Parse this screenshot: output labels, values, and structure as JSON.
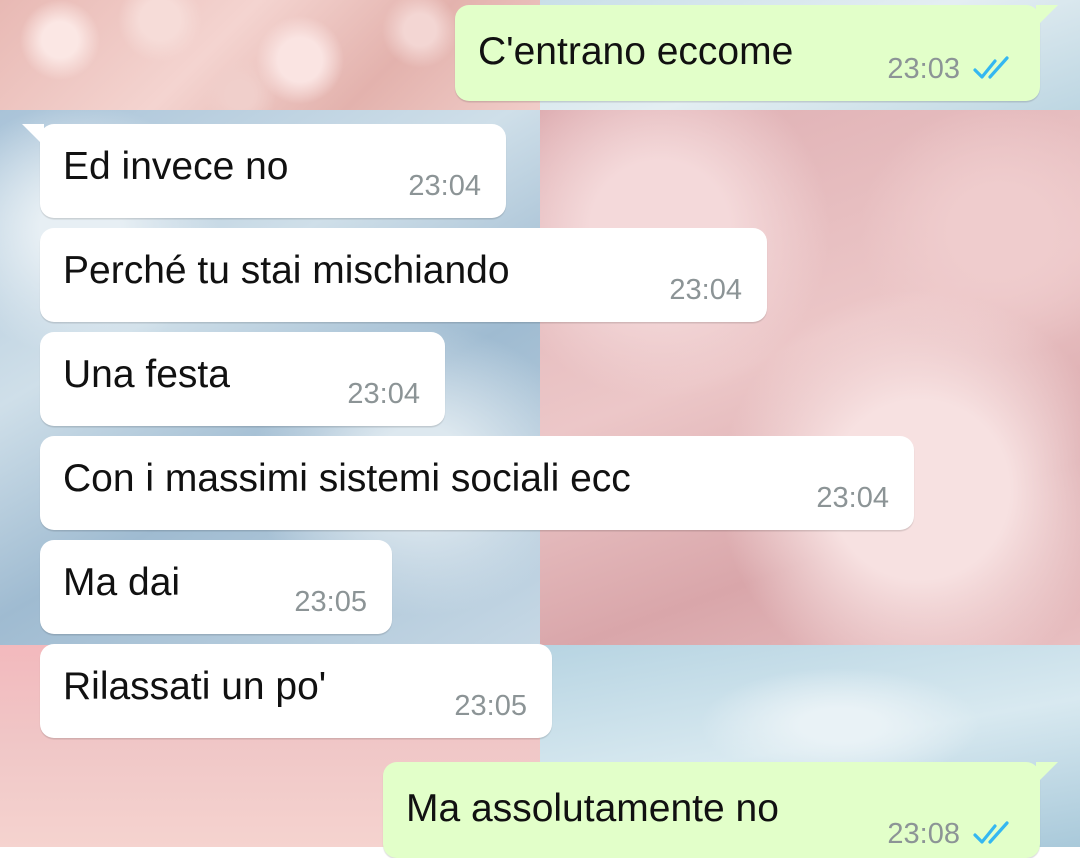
{
  "theme": {
    "incoming_bubble_color": "#ffffff",
    "outgoing_bubble_color": "#e2ffc9",
    "timestamp_color": "#8c9496",
    "read_ticks_color": "#34b7f1"
  },
  "messages": [
    {
      "direction": "outgoing",
      "text": "C'entrano eccome",
      "time": "23:03",
      "status": "read",
      "status_icon": "double-check-icon"
    },
    {
      "direction": "incoming",
      "text": "Ed invece no",
      "time": "23:04"
    },
    {
      "direction": "incoming",
      "text": "Perché tu stai mischiando",
      "time": "23:04"
    },
    {
      "direction": "incoming",
      "text": "Una festa",
      "time": "23:04"
    },
    {
      "direction": "incoming",
      "text": "Con i massimi sistemi sociali ecc",
      "time": "23:04"
    },
    {
      "direction": "incoming",
      "text": "Ma dai",
      "time": "23:05"
    },
    {
      "direction": "incoming",
      "text": "Rilassati un po'",
      "time": "23:05"
    },
    {
      "direction": "outgoing",
      "text": "Ma assolutamente no",
      "time": "23:08",
      "status": "read",
      "status_icon": "double-check-icon"
    }
  ]
}
